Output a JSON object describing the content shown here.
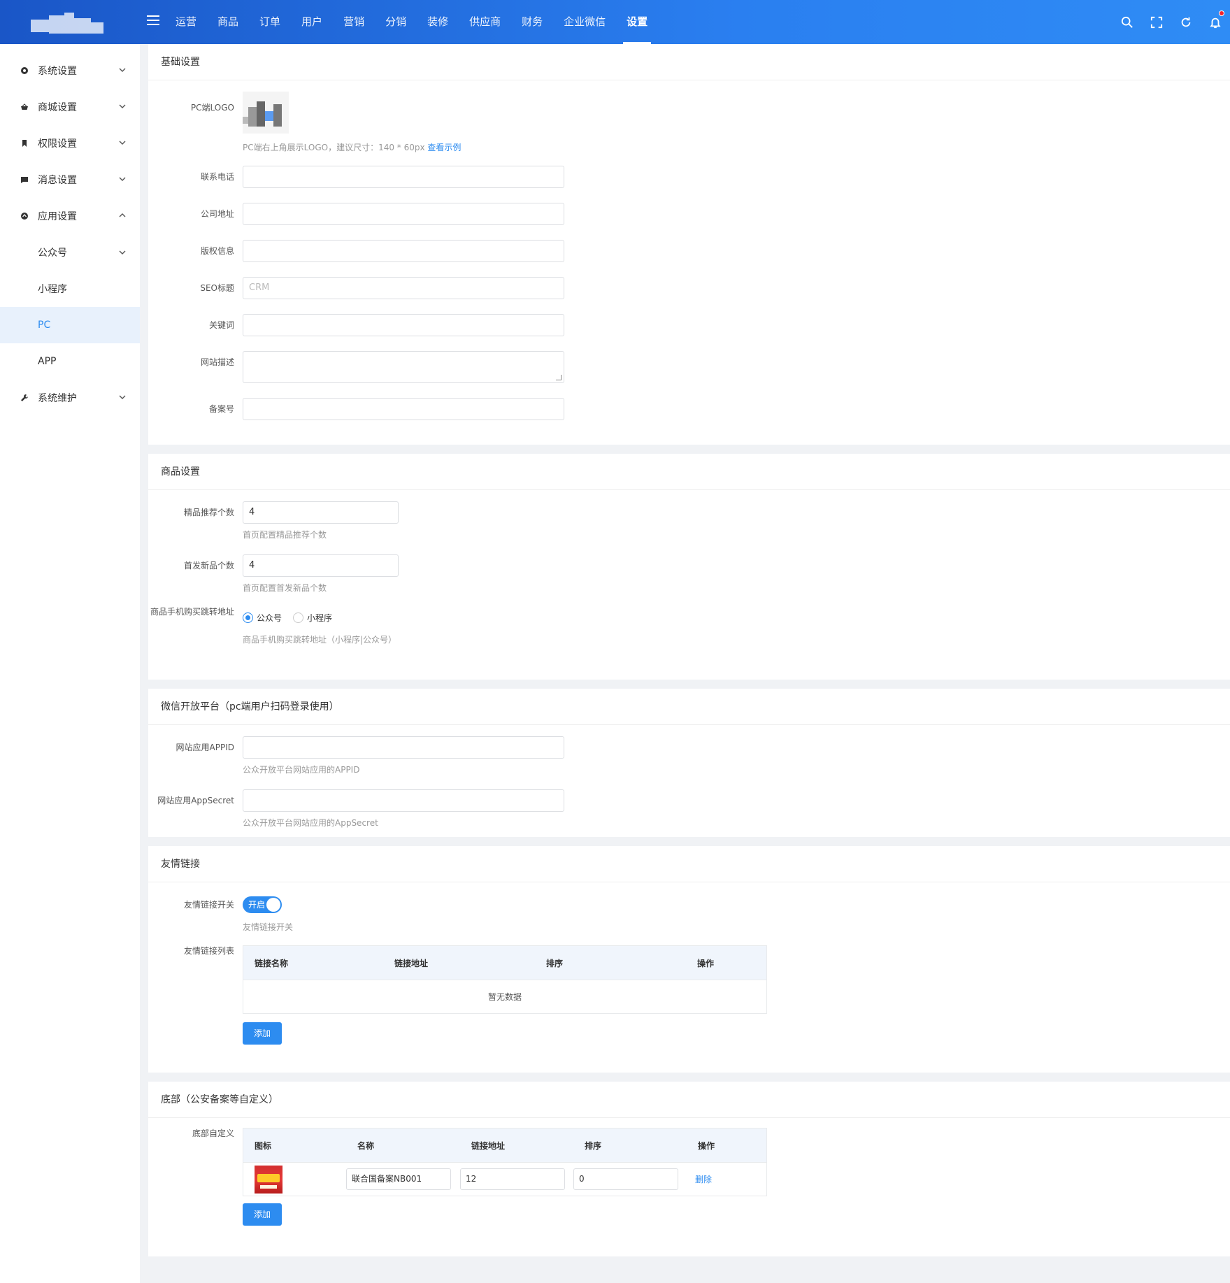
{
  "header": {
    "nav": [
      "运营",
      "商品",
      "订单",
      "用户",
      "营销",
      "分销",
      "装修",
      "供应商",
      "财务",
      "企业微信",
      "设置"
    ],
    "active_index": 10
  },
  "sidebar": {
    "items": [
      {
        "label": "系统设置",
        "icon": "settings-icon",
        "expanded": false
      },
      {
        "label": "商城设置",
        "icon": "shop-basket-icon",
        "expanded": false
      },
      {
        "label": "权限设置",
        "icon": "bookmark-icon",
        "expanded": false
      },
      {
        "label": "消息设置",
        "icon": "message-icon",
        "expanded": false
      },
      {
        "label": "应用设置",
        "icon": "app-icon",
        "expanded": true
      },
      {
        "label": "系统维护",
        "icon": "wrench-icon",
        "expanded": false
      }
    ],
    "sub_items": [
      {
        "label": "公众号",
        "has_chevron": true
      },
      {
        "label": "小程序"
      },
      {
        "label": "PC",
        "active": true
      },
      {
        "label": "APP"
      }
    ]
  },
  "basic": {
    "title": "基础设置",
    "logo_label": "PC端LOGO",
    "logo_help": "PC端右上角展示LOGO，建议尺寸：140 * 60px",
    "logo_help_link": "查看示例",
    "phone_label": "联系电话",
    "phone_value": "",
    "address_label": "公司地址",
    "address_value": "",
    "copyright_label": "版权信息",
    "copyright_value": "",
    "seo_title_label": "SEO标题",
    "seo_title_value": "CRM",
    "keywords_label": "关键词",
    "keywords_value": "",
    "desc_label": "网站描述",
    "icp_label": "备案号",
    "icp_value": ""
  },
  "goods": {
    "title": "商品设置",
    "rec_label": "精品推荐个数",
    "rec_value": "4",
    "rec_help": "首页配置精品推荐个数",
    "new_label": "首发新品个数",
    "new_value": "4",
    "new_help": "首页配置首发新品个数",
    "jump_label": "商品手机购买跳转地址",
    "jump_options": [
      "公众号",
      "小程序"
    ],
    "jump_selected": 0,
    "jump_help": "商品手机购买跳转地址（小程序|公众号）"
  },
  "wechat_open": {
    "title": "微信开放平台（pc端用户扫码登录使用）",
    "appid_label": "网站应用APPID",
    "appid_value": "",
    "appid_help": "公众开放平台网站应用的APPID",
    "secret_label": "网站应用AppSecret",
    "secret_value": "",
    "secret_help": "公众开放平台网站应用的AppSecret"
  },
  "links": {
    "title": "友情链接",
    "switch_label": "友情链接开关",
    "switch_text": "开启",
    "switch_help": "友情链接开关",
    "list_label": "友情链接列表",
    "columns": [
      "链接名称",
      "链接地址",
      "排序",
      "操作"
    ],
    "empty_text": "暂无数据",
    "add_label": "添加"
  },
  "footer": {
    "title": "底部（公安备案等自定义）",
    "custom_label": "底部自定义",
    "columns": [
      "图标",
      "名称",
      "链接地址",
      "排序",
      "操作"
    ],
    "rows": [
      {
        "name": "联合国备案NB001",
        "url": "12",
        "sort": "0",
        "action": "删除"
      }
    ],
    "add_label": "添加"
  }
}
